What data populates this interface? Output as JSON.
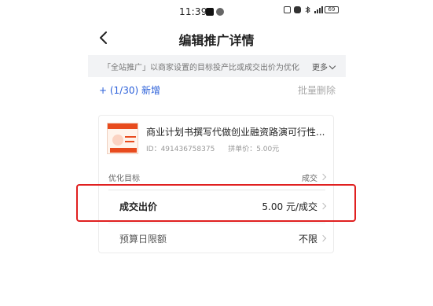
{
  "status_bar": {
    "time": "11:39",
    "battery": "69",
    "icons": [
      "tiktok-icon",
      "app-icon",
      "nfc-icon",
      "silent-icon",
      "bluetooth-icon",
      "signal-icon",
      "battery-icon"
    ]
  },
  "header": {
    "title": "编辑推广详情",
    "back_icon": "chevron-left-icon"
  },
  "notice": {
    "text": "「全站推广」以商家设置的目标投产比或成交出价为优化",
    "more_label": "更多"
  },
  "toolbar": {
    "add_label": "+ (1/30) 新增",
    "batch_delete_label": "批量删除"
  },
  "product": {
    "title": "商业计划书撰写代做创业融资路演可行性...",
    "id_text": "ID：491436758375",
    "price_text": "拼单价：5.00元"
  },
  "settings": {
    "target_label": "优化目标",
    "target_value": "成交",
    "price_label": "成交出价",
    "price_value": "5.00 元/成交",
    "budget_label": "预算日限额",
    "budget_value": "不限"
  },
  "colors": {
    "accent_blue": "#2a5fd9",
    "highlight_red": "#e02020",
    "product_red": "#e84b1e"
  }
}
